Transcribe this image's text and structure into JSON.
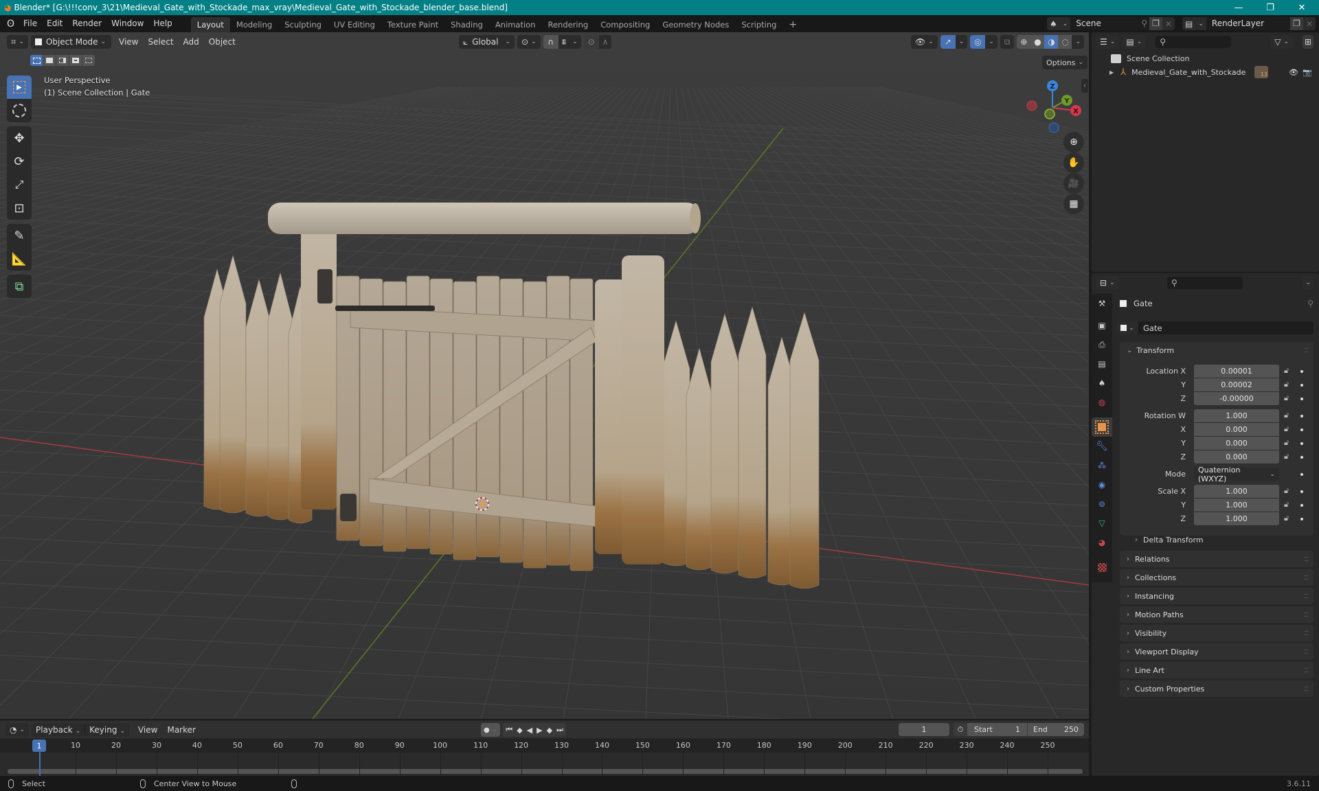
{
  "window": {
    "title": "Blender* [G:\\!!!conv_3\\21\\Medieval_Gate_with_Stockade_max_vray\\Medieval_Gate_with_Stockade_blender_base.blend]",
    "controls": [
      "minimize",
      "maximize",
      "close"
    ]
  },
  "menubar": {
    "menus": [
      "File",
      "Edit",
      "Render",
      "Window",
      "Help"
    ],
    "workspaces": [
      "Layout",
      "Modeling",
      "Sculpting",
      "UV Editing",
      "Texture Paint",
      "Shading",
      "Animation",
      "Rendering",
      "Compositing",
      "Geometry Nodes",
      "Scripting"
    ],
    "active_workspace": "Layout",
    "add_workspace": "+",
    "scene_name": "Scene",
    "view_layer": "RenderLayer"
  },
  "viewport_header": {
    "mode": "Object Mode",
    "menus": [
      "View",
      "Select",
      "Add",
      "Object"
    ],
    "transform_orientation": "Global",
    "options_label": "Options"
  },
  "viewport": {
    "overlay_line1": "User Perspective",
    "overlay_line2": "(1) Scene Collection | Gate",
    "gizmo_axes": [
      "X",
      "Y",
      "Z"
    ],
    "nav_buttons": [
      "zoom-icon",
      "hand-pan-icon",
      "camera-icon",
      "grid-ortho-icon"
    ],
    "tools": [
      "select-box",
      "cursor",
      "move",
      "rotate",
      "scale",
      "transform",
      "annotate",
      "measure",
      "add-cube"
    ],
    "selection_modes": [
      "new",
      "extend",
      "subtract",
      "invert",
      "intersect"
    ],
    "colors": {
      "background": "#3a3a3a",
      "grid": "#4a4a4a",
      "x_axis": "#c8343c",
      "y_axis": "#6e9a28",
      "wood_light": "#b8ab98",
      "wood_dark": "#8e6a42"
    }
  },
  "outliner": {
    "root": "Scene Collection",
    "items": [
      {
        "name": "Medieval_Gate_with_Stockade",
        "badge": "13",
        "visible": true
      }
    ]
  },
  "properties": {
    "object_name_header": "Gate",
    "object_name_field": "Gate",
    "tabs": [
      "tool",
      "render",
      "output",
      "view-layer",
      "scene",
      "world",
      "object",
      "modifiers",
      "particles",
      "physics",
      "constraints",
      "data",
      "material",
      "texture"
    ],
    "active_tab": "object",
    "transform": {
      "label": "Transform",
      "location": {
        "label": "Location X",
        "x": "0.00001",
        "y": "0.00002",
        "z": "-0.00000"
      },
      "rotation": {
        "label": "Rotation W",
        "w": "1.000",
        "x": "0.000",
        "y": "0.000",
        "z": "0.000"
      },
      "mode_label": "Mode",
      "mode_value": "Quaternion (WXYZ)",
      "scale": {
        "label": "Scale X",
        "x": "1.000",
        "y": "1.000",
        "z": "1.000"
      },
      "axis_labels": {
        "x": "X",
        "y": "Y",
        "z": "Z"
      },
      "delta": "Delta Transform"
    },
    "panels": [
      "Relations",
      "Collections",
      "Instancing",
      "Motion Paths",
      "Visibility",
      "Viewport Display",
      "Line Art",
      "Custom Properties"
    ]
  },
  "timeline": {
    "menus": [
      "Playback",
      "Keying",
      "View",
      "Marker"
    ],
    "current_frame": "1",
    "start_label": "Start",
    "start": "1",
    "end_label": "End",
    "end": "250",
    "ruler": [
      "1",
      "10",
      "20",
      "30",
      "40",
      "50",
      "60",
      "70",
      "80",
      "90",
      "100",
      "110",
      "120",
      "130",
      "140",
      "150",
      "160",
      "170",
      "180",
      "190",
      "200",
      "210",
      "220",
      "230",
      "240",
      "250"
    ]
  },
  "statusbar": {
    "left_action": "Select",
    "middle_action": "Center View to Mouse",
    "version": "3.6.11"
  }
}
